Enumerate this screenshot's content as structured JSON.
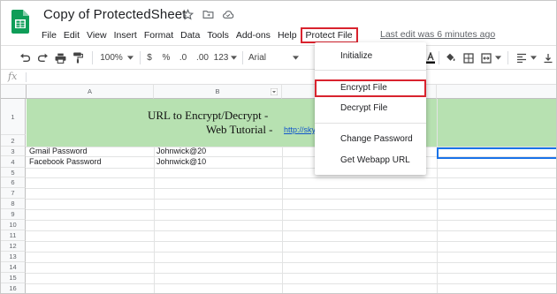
{
  "doc": {
    "title": "Copy of ProtectedSheet"
  },
  "menu": {
    "items": [
      "File",
      "Edit",
      "View",
      "Insert",
      "Format",
      "Data",
      "Tools",
      "Add-ons",
      "Help",
      "Protect File"
    ],
    "last_edit": "Last edit was 6 minutes ago"
  },
  "toolbar": {
    "zoom": "100%",
    "currency": "$",
    "percent": "%",
    "dec_less": ".0",
    "dec_more": ".00",
    "more_formats": "123",
    "font": "Arial"
  },
  "formula": {
    "fx": "fx"
  },
  "grid": {
    "columns": [
      "A",
      "B"
    ],
    "rows": [
      "1",
      "2",
      "3",
      "4",
      "5",
      "6",
      "7",
      "8",
      "9",
      "10",
      "11",
      "12",
      "13",
      "14",
      "15",
      "16"
    ],
    "merged_line1": "URL to Encrypt/Decrypt -",
    "merged_line2": "Web Tutorial -",
    "link": "http://sky",
    "cells": [
      {
        "a": "Gmail Password",
        "b": "Johnwick@20"
      },
      {
        "a": "Facebook Password",
        "b": "Johnwick@10"
      }
    ]
  },
  "dropdown": {
    "items": [
      "Initialize",
      "Encrypt File",
      "Decrypt File",
      "Change Password",
      "Get Webapp URL"
    ]
  },
  "colors": {
    "accent": "#1a73e8",
    "highlight_box": "#d9232e",
    "merged_fill": "#b7e1b1",
    "sheets_green": "#0f9d58"
  }
}
